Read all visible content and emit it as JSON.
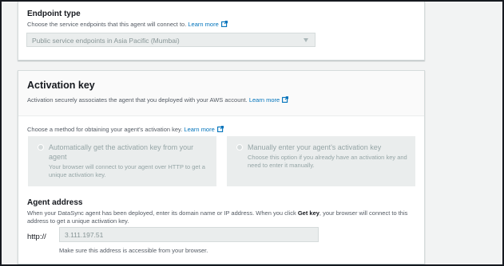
{
  "endpoint": {
    "label": "Endpoint type",
    "description": "Choose the service endpoints that this agent will connect to.",
    "learn_more": "Learn more",
    "selected": "Public service endpoints in Asia Pacific (Mumbai)"
  },
  "activation": {
    "title": "Activation key",
    "description": "Activation securely associates the agent that you deployed with your AWS account.",
    "learn_more": "Learn more",
    "method_description": "Choose a method for obtaining your agent's activation key.",
    "method_learn_more": "Learn more",
    "options": [
      {
        "title": "Automatically get the activation key from your agent",
        "description": "Your browser will connect to your agent over HTTP to get a unique activation key.",
        "selected": false
      },
      {
        "title": "Manually enter your agent's activation key",
        "description": "Choose this option if you already have an activation key and need to enter it manually.",
        "selected": false
      }
    ]
  },
  "agent_address": {
    "label": "Agent address",
    "description_pre": "When your DataSync agent has been deployed, enter its domain name or IP address. When you click ",
    "description_bold": "Get key",
    "description_post": ", your browser will connect to this address to get a unique activation key.",
    "protocol": "http://",
    "value": "3.111.197.51",
    "hint": "Make sure this address is accessible from your browser."
  },
  "colors": {
    "link": "#0073bb",
    "frame_border": "#16191f",
    "disabled_fill": "#eaeded"
  },
  "icons": {
    "external_link": "external-link-icon",
    "dropdown": "caret-down-icon"
  }
}
